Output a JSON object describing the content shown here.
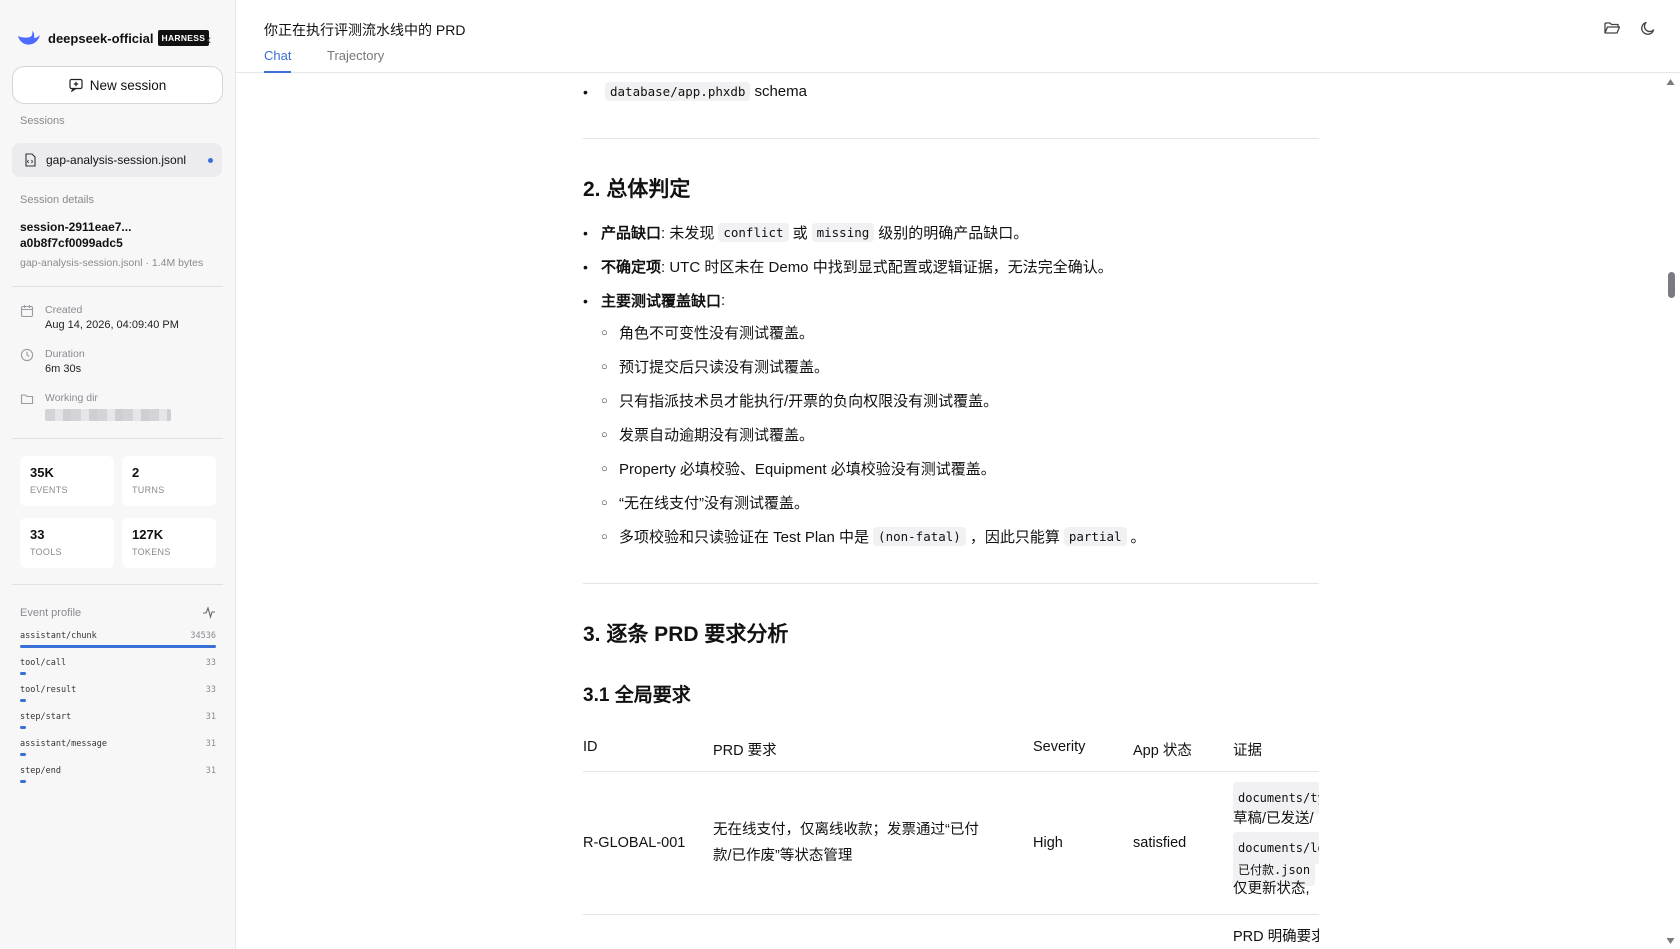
{
  "sidebar": {
    "brand_name": "deepseek-official",
    "brand_badge": "HARNESS",
    "collapse_glyph": "‹",
    "new_session_label": "New session",
    "sessions_heading": "Sessions",
    "session_item": "gap-analysis-session.jsonl",
    "details_heading": "Session details",
    "session_id_line1": "session-2911eae7...",
    "session_id_line2": "a0b8f7cf0099adc5",
    "session_meta": "gap-analysis-session.jsonl · 1.4M bytes",
    "created_label": "Created",
    "created_value": "Aug 14, 2026, 04:09:40 PM",
    "duration_label": "Duration",
    "duration_value": "6m 30s",
    "workdir_label": "Working dir",
    "stats": [
      {
        "value": "35K",
        "label": "EVENTS"
      },
      {
        "value": "2",
        "label": "TURNS"
      },
      {
        "value": "33",
        "label": "TOOLS"
      },
      {
        "value": "127K",
        "label": "TOKENS"
      }
    ],
    "profile_heading": "Event profile",
    "profile": [
      {
        "name": "assistant/chunk",
        "count": 34536
      },
      {
        "name": "tool/call",
        "count": 33
      },
      {
        "name": "tool/result",
        "count": 33
      },
      {
        "name": "step/start",
        "count": 31
      },
      {
        "name": "assistant/message",
        "count": 31
      },
      {
        "name": "step/end",
        "count": 31
      }
    ]
  },
  "header": {
    "title": "你正在执行评测流水线中的 PRD",
    "tabs": [
      "Chat",
      "Trajectory"
    ]
  },
  "content": {
    "top_bullet_code": "database/app.phxdb",
    "top_bullet_text": "schema",
    "h2_overall": "2. 总体判定",
    "b1_strong": "产品缺口",
    "b1_pre": ": 未发现",
    "b1_code1": "conflict",
    "b1_mid": "或",
    "b1_code2": "missing",
    "b1_post": "级别的明确产品缺口。",
    "b2_strong": "不确定项",
    "b2_text": ": UTC 时区未在 Demo 中找到显式配置或逻辑证据，无法完全确认。",
    "b3_strong": "主要测试覆盖缺口",
    "b3_colon": ":",
    "sub_items": [
      "角色不可变性没有测试覆盖。",
      "预订提交后只读没有测试覆盖。",
      "只有指派技术员才能执行/开票的负向权限没有测试覆盖。",
      "发票自动逾期没有测试覆盖。",
      "Property 必填校验、Equipment 必填校验没有测试覆盖。",
      "“无在线支付”没有测试覆盖。"
    ],
    "last_sub_pre": "多项校验和只读验证在 Test Plan 中是",
    "last_sub_code1": "(non-fatal)",
    "last_sub_mid": "，因此只能算",
    "last_sub_code2": "partial",
    "last_sub_post": "。",
    "h2_prd": "3. 逐条 PRD 要求分析",
    "h3_global": "3.1 全局要求",
    "table": {
      "headers": [
        "ID",
        "PRD 要求",
        "Severity",
        "App 状态",
        "证据"
      ],
      "row1": {
        "id": "R-GLOBAL-001",
        "req_line1": "无在线支付，仅离线收款；发票通过“已付",
        "req_line2": "款/已作废”等状态管理",
        "severity": "High",
        "status": "satisfied",
        "ev_code1": "documents/ty",
        "ev_text1": "草稿/已发送/",
        "ev_code2": "documents/lo",
        "ev_code3": "已付款.json",
        "ev_text2": "仅更新状态,"
      },
      "row2_evidence": "PRD 明确要求"
    }
  }
}
